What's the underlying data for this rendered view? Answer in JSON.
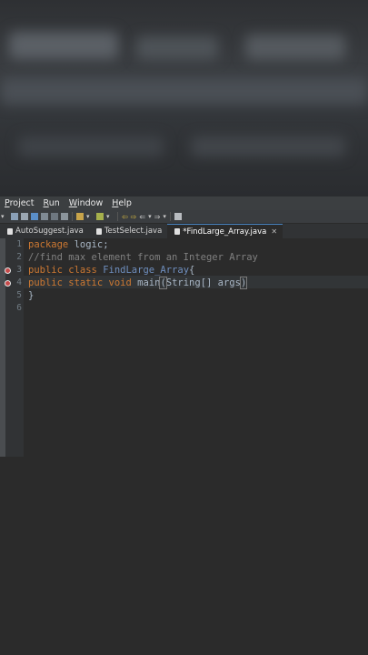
{
  "menu": {
    "items": [
      {
        "label": "Project",
        "mnemonic": "P",
        "rest": "roject"
      },
      {
        "label": "Run",
        "mnemonic": "R",
        "rest": "un"
      },
      {
        "label": "Window",
        "mnemonic": "W",
        "rest": "indow"
      },
      {
        "label": "Help",
        "mnemonic": "H",
        "rest": "elp"
      }
    ]
  },
  "tabs": [
    {
      "label": "AutoSuggest.java",
      "active": false
    },
    {
      "label": "TestSelect.java",
      "active": false
    },
    {
      "label": "*FindLarge_Array.java",
      "active": true,
      "close": "✕"
    }
  ],
  "editor": {
    "lines": [
      {
        "num": "1",
        "tokens": [
          {
            "t": "package",
            "c": "kw"
          },
          {
            "t": " logic;",
            "c": "plain"
          }
        ]
      },
      {
        "num": "2",
        "tokens": [
          {
            "t": "//find max element from an Integer Array",
            "c": "cmt"
          }
        ]
      },
      {
        "num": "3",
        "tokens": [
          {
            "t": "public",
            "c": "kw"
          },
          {
            "t": " ",
            "c": "plain"
          },
          {
            "t": "class",
            "c": "kw"
          },
          {
            "t": " ",
            "c": "plain"
          },
          {
            "t": "FindLarge_Array",
            "c": "cls"
          },
          {
            "t": "{",
            "c": "plain"
          }
        ]
      },
      {
        "num": "4",
        "tokens": [
          {
            "t": "public",
            "c": "kw"
          },
          {
            "t": " ",
            "c": "plain"
          },
          {
            "t": "static",
            "c": "kw"
          },
          {
            "t": " ",
            "c": "plain"
          },
          {
            "t": "void",
            "c": "kw"
          },
          {
            "t": " main",
            "c": "plain"
          },
          {
            "t": "(",
            "c": "bracket"
          },
          {
            "t": "String[] args",
            "c": "plain"
          },
          {
            "t": ")",
            "c": "bracket"
          }
        ]
      },
      {
        "num": "5",
        "tokens": [
          {
            "t": "}",
            "c": "plain"
          }
        ]
      },
      {
        "num": "6",
        "tokens": []
      }
    ],
    "error_lines": [
      3,
      4
    ],
    "current_line": 4
  },
  "colors": {
    "background": "#2b2b2b",
    "keyword": "#cc7832",
    "comment": "#808080",
    "class_name": "#6f8fbf",
    "error_marker": "#c64a4a"
  }
}
